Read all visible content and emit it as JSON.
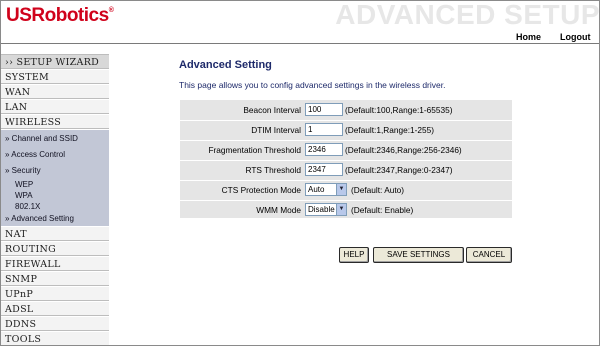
{
  "header": {
    "logo_text": "USRobotics",
    "logo_mark": "®",
    "banner": "ADVANCED SETUP",
    "nav": {
      "home": "Home",
      "logout": "Logout"
    }
  },
  "sidebar": {
    "wizard": "›› SETUP WIZARD",
    "items": [
      "SYSTEM",
      "WAN",
      "LAN",
      "WIRELESS"
    ],
    "wireless_sub": {
      "channel": "» Channel and SSID",
      "access": "» Access Control",
      "security": "» Security",
      "wep": "WEP",
      "wpa": "WPA",
      "x8021": "802.1X",
      "advanced": "» Advanced Setting"
    },
    "items_bottom": [
      "NAT",
      "ROUTING",
      "FIREWALL",
      "SNMP",
      "UPnP",
      "ADSL",
      "DDNS",
      "TOOLS"
    ]
  },
  "main": {
    "title": "Advanced Setting",
    "description": "This page allows you to config advanced settings in the wireless driver.",
    "fields": {
      "beacon": {
        "label": "Beacon Interval",
        "value": "100",
        "hint": "(Default:100,Range:1-65535)"
      },
      "dtim": {
        "label": "DTIM Interval",
        "value": "1",
        "hint": "(Default:1,Range:1-255)"
      },
      "frag": {
        "label": "Fragmentation Threshold",
        "value": "2346",
        "hint": "(Default:2346,Range:256-2346)"
      },
      "rts": {
        "label": "RTS Threshold",
        "value": "2347",
        "hint": "(Default:2347,Range:0-2347)"
      },
      "cts": {
        "label": "CTS Protection Mode",
        "value": "Auto",
        "hint": "(Default: Auto)"
      },
      "wmm": {
        "label": "WMM Mode",
        "value": "Disable",
        "hint": "(Default: Enable)"
      }
    },
    "buttons": {
      "help": "HELP",
      "save": "SAVE SETTINGS",
      "cancel": "CANCEL"
    }
  },
  "colors": {
    "brand_red": "#d0021b",
    "title_blue": "#1e2a6a",
    "sub_menu_bg": "#c2c7d6",
    "table_bg": "#e5e5e5"
  }
}
